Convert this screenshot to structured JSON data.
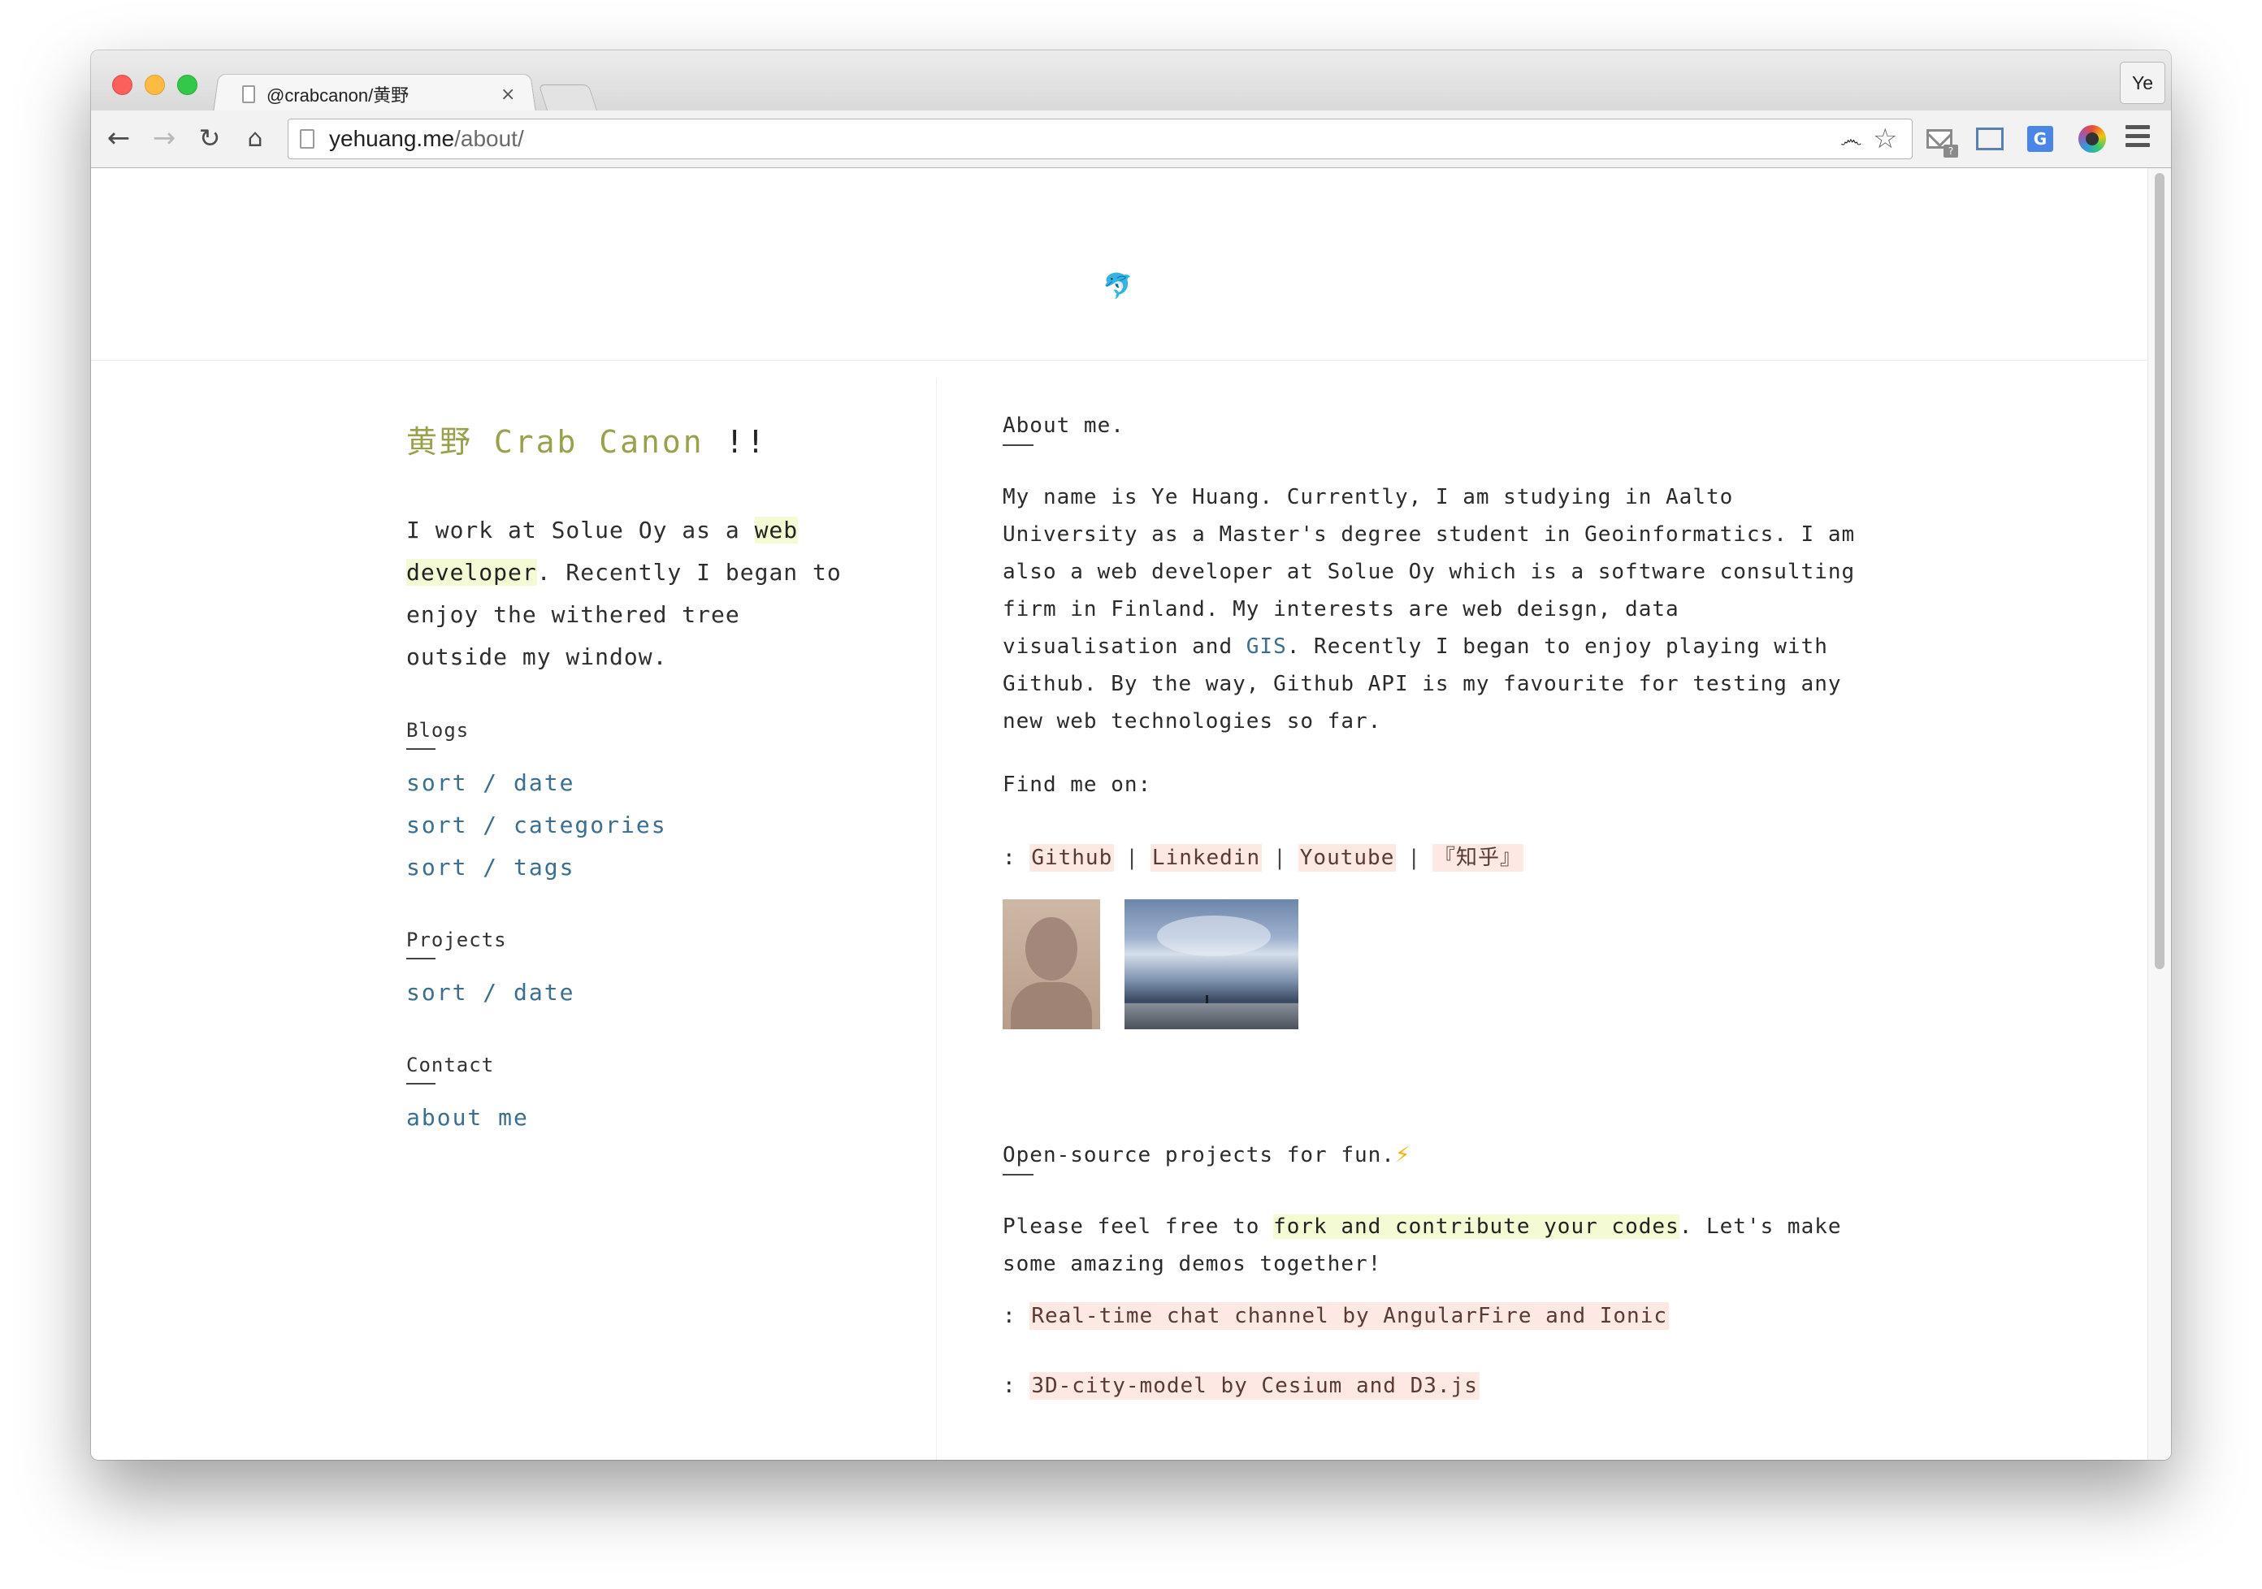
{
  "browser": {
    "tab_title": "@crabcanon/黄野",
    "tab_close": "×",
    "profile": "Ye",
    "url_host": "yehuang.me",
    "url_path": "/about/",
    "mail_badge": "?",
    "translate_letter": "G"
  },
  "site": {
    "title_cn": "黄野",
    "title_en": "Crab Canon",
    "title_bang": "!!",
    "intro_part1": "I work at Solue Oy as a ",
    "intro_highlight": "web developer",
    "intro_part2": ". Recently I began to enjoy the withered tree outside my window.",
    "sections": {
      "blogs": {
        "label": "Blogs",
        "links": [
          "sort / date",
          "sort / categories",
          "sort / tags"
        ]
      },
      "projects": {
        "label": "Projects",
        "links": [
          "sort / date"
        ]
      },
      "contact": {
        "label": "Contact",
        "links": [
          "about me"
        ]
      }
    }
  },
  "about": {
    "heading": "About me.",
    "para_part1": "My name is Ye Huang. Currently, I am studying in Aalto University as a Master's degree student in Geoinformatics. I am also a web developer at Solue Oy which is a software consulting firm in Finland. My interests are web deisgn, data visualisation and ",
    "para_link": "GIS",
    "para_part2": ". Recently I began to enjoy playing with Github. By the way, Github API is my favourite for testing any new web technologies so far.",
    "find_me": "Find me on:",
    "social_prefix": ":",
    "social_links": [
      "Github",
      "Linkedin",
      "Youtube",
      "『知乎』"
    ],
    "social_sep": "|"
  },
  "open_source": {
    "heading": "Open-source projects for fun.",
    "heading_icon": "⚡",
    "para_part1": "Please feel free to ",
    "para_highlight": "fork and contribute your codes",
    "para_part2": ". Let's make some amazing demos together!",
    "projects": [
      "Real-time chat channel by AngularFire and Ionic",
      "3D-city-model by Cesium and D3.js"
    ],
    "project_prefix": ":"
  },
  "colors": {
    "title_green": "#9aa04b",
    "link_blue": "#3b6e8f",
    "highlight_yellow": "#f4fad3",
    "pill_pink": "#fde8e4"
  }
}
